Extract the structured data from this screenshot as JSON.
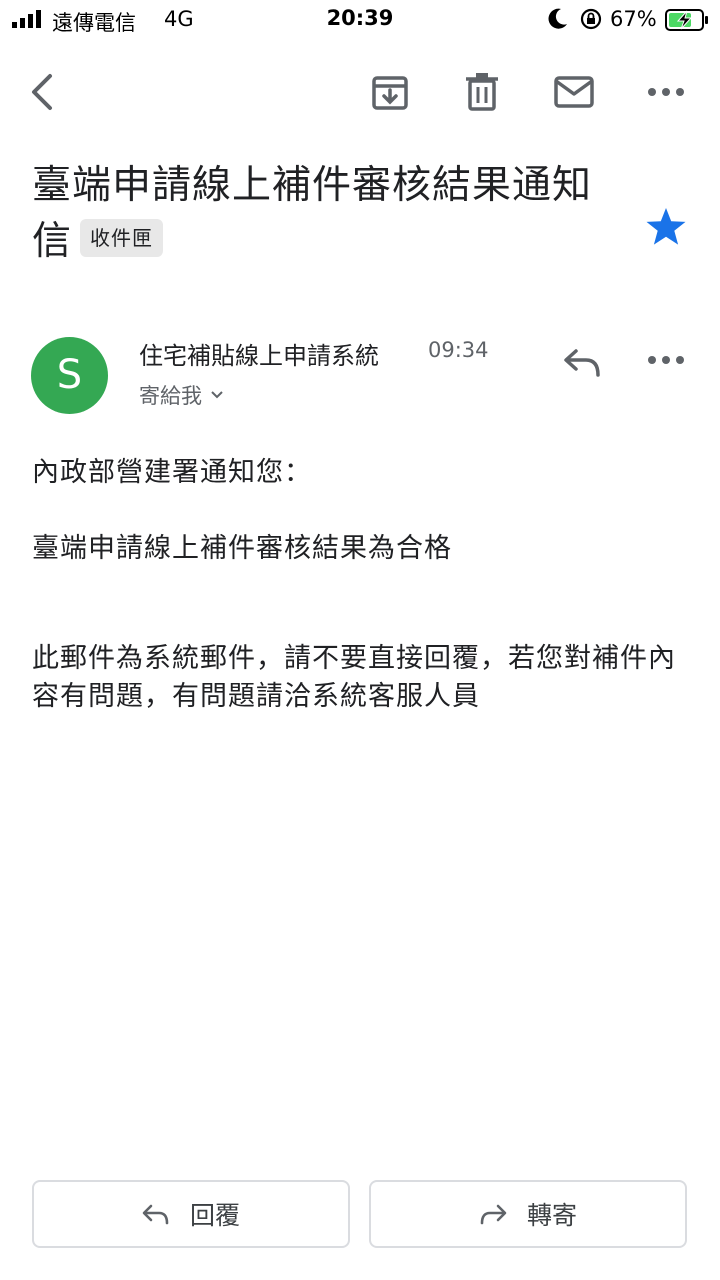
{
  "status_bar": {
    "carrier": "遠傳電信",
    "network": "4G",
    "time": "20:39",
    "battery_percent": "67%"
  },
  "toolbar": {
    "icons": [
      "back-icon",
      "archive-icon",
      "delete-icon",
      "mark-unread-icon",
      "more-icon"
    ]
  },
  "email": {
    "subject": "臺端申請線上補件審核結果通知信",
    "label": "收件匣",
    "starred": true,
    "star_color": "#1a73e8",
    "sender_initial": "S",
    "avatar_color": "#34a853",
    "sender_name": "住宅補貼線上申請系統",
    "time": "09:34",
    "recipient": "寄給我",
    "body": {
      "greeting": "內政部營建署通知您：",
      "result": "臺端申請線上補件審核結果為合格",
      "notice": "此郵件為系統郵件，請不要直接回覆，若您對補件內容有問題，有問題請洽系統客服人員"
    }
  },
  "actions": {
    "reply_label": "回覆",
    "forward_label": "轉寄"
  }
}
